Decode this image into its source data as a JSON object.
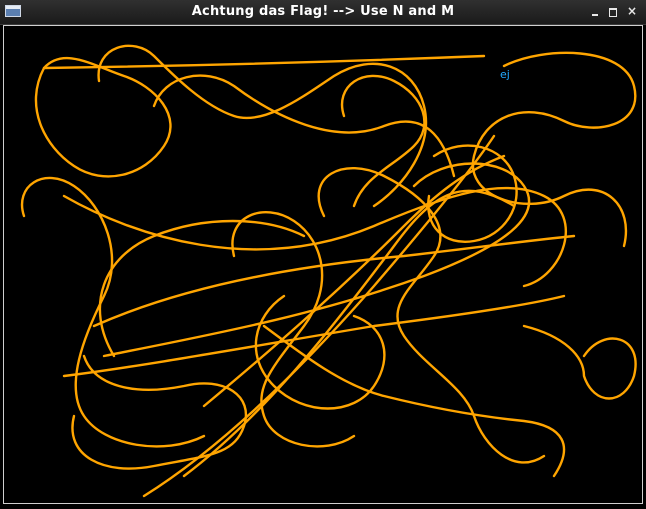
{
  "window": {
    "title": "Achtung das Flag! --> Use N and M",
    "buttons": {
      "minimize_icon": "minimize-icon",
      "maximize_icon": "maximize-icon",
      "close_icon": "close-icon"
    }
  },
  "game": {
    "background_color": "#000000",
    "trail_color": "#ffa500",
    "player_label": "ej",
    "player_label_color": "#22aaff"
  }
}
